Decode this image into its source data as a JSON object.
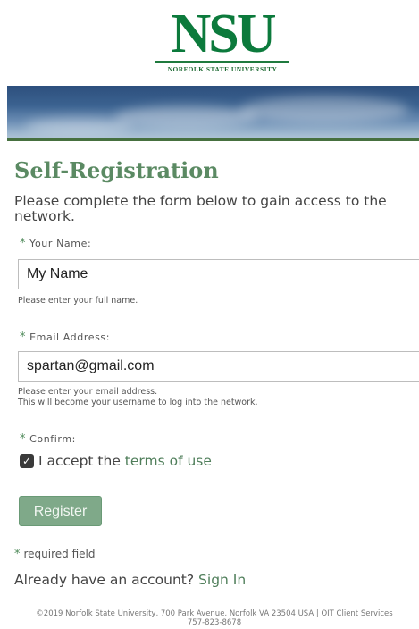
{
  "logo": {
    "letters": "NSU",
    "subtitle": "NORFOLK STATE UNIVERSITY"
  },
  "title": "Self-Registration",
  "intro": "Please complete the form below to gain access to the network.",
  "fields": {
    "name": {
      "label": "Your Name:",
      "value": "My Name",
      "hint": "Please enter your full name."
    },
    "email": {
      "label": "Email Address:",
      "value": "spartan@gmail.com",
      "hint_line1": "Please enter your email address.",
      "hint_line2": "This will become your username to log into the network."
    },
    "confirm": {
      "label": "Confirm:",
      "accept_prefix": "I accept the",
      "terms_link": "terms of use",
      "checked": true
    }
  },
  "required_star": "*",
  "register_button": "Register",
  "required_note": "required field",
  "account": {
    "prompt": "Already have an account?",
    "link": "Sign In"
  },
  "footer": {
    "line1": "©2019 Norfolk State University, 700 Park Avenue, Norfolk VA 23504 USA | OIT Client Services",
    "line2": "757-823-8678"
  },
  "colors": {
    "brand_green": "#0c7a3c",
    "heading_green": "#5b8a63",
    "link_green": "#4f7e5a",
    "button_green": "#7fa989"
  }
}
